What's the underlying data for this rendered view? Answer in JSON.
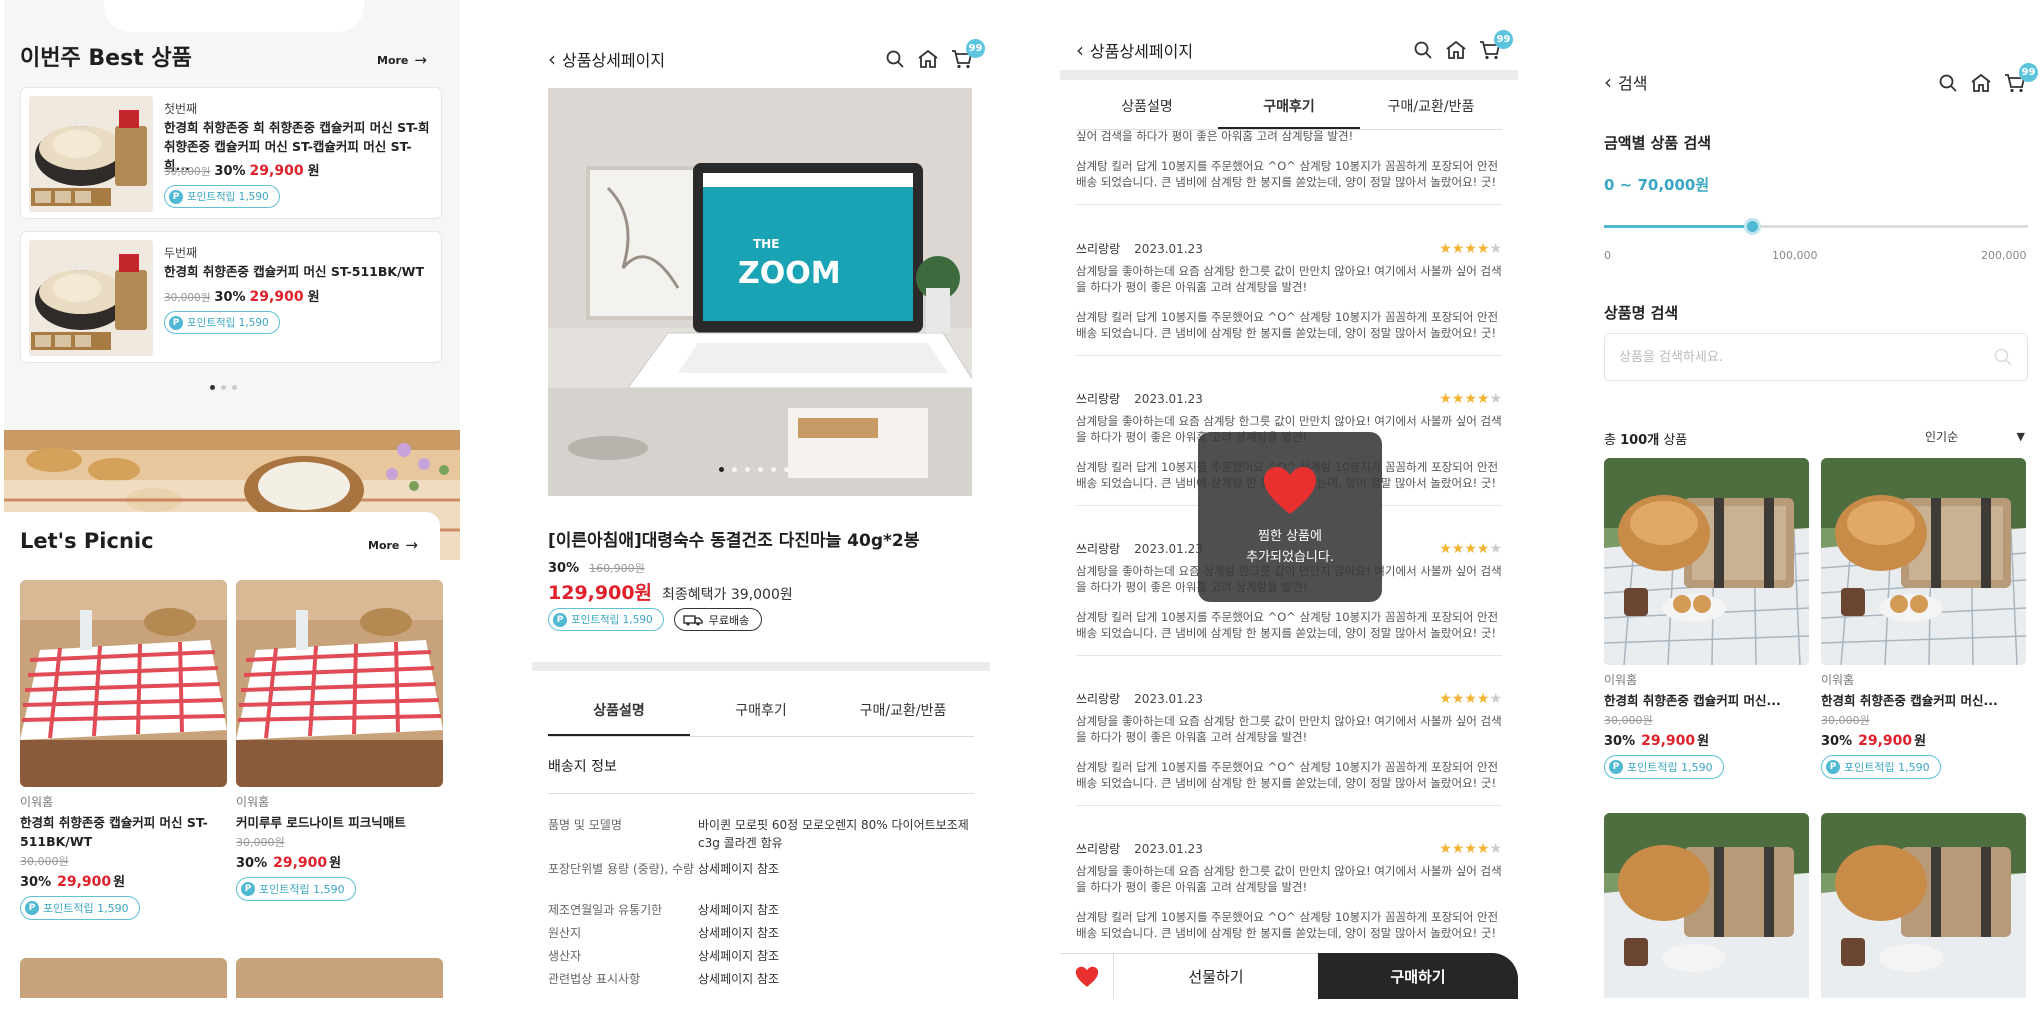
{
  "panel1": {
    "best_title": "이번주 Best 상품",
    "more_label": "More",
    "best_items": [
      {
        "rank": "첫번째",
        "name": "한경희 취향존중 희 취향존중 캡슐커피 머신 ST-희 취향존중 캡슐커피 머신 ST-캡슐커피 머신 ST-희...",
        "orig": "30,000원",
        "pct": "30%",
        "sale": "29,900",
        "won": "원",
        "point": "포인트적립 1,590"
      },
      {
        "rank": "두번째",
        "name": "한경희 취향존중 캡슐커피 머신 ST-511BK/WT",
        "orig": "30,000원",
        "pct": "30%",
        "sale": "29,900",
        "won": "원",
        "point": "포인트적립 1,590"
      }
    ],
    "picnic_title": "Let's Picnic",
    "picnic_items": [
      {
        "brand": "이워홈",
        "name": "한경희 취향존중 캡슐커피 머신 ST-511BK/WT",
        "orig": "30,000원",
        "pct": "30%",
        "sale": "29,900",
        "won": "원",
        "point": "포인트적립 1,590"
      },
      {
        "brand": "이워홈",
        "name": "커미루루 로드나이트 피크닉매트",
        "orig": "30,000원",
        "pct": "30%",
        "sale": "29,900",
        "won": "원",
        "point": "포인트적립 1,590"
      }
    ]
  },
  "panel2": {
    "header_title": "상품상세페이지",
    "cart_count": "99",
    "product_name": "[이른아침애]대령숙수 동결건조 다진마늘 40g*2봉",
    "discount_pct": "30%",
    "orig_price": "160,900원",
    "sale_price": "129,900원",
    "final_price": "최종혜택가 39,000원",
    "point": "포인트적립 1,590",
    "free_ship": "무료배송",
    "tabs": [
      "상품설명",
      "구매후기",
      "구매/교환/반품"
    ],
    "section": "배송지 정보",
    "specs": [
      {
        "k": "품명 및 모델명",
        "v": "바이퀸 모로핏 60정 모로오렌지 80% 다이어트보조제 c3g 콜라겐 함유"
      },
      {
        "k": "포장단위별 용량 (중량), 수량",
        "v": "상세페이지 참조"
      },
      {
        "k": "제조연월일과 유통기한",
        "v": "상세페이지 참조"
      },
      {
        "k": "원산지",
        "v": "상세페이지 참조"
      },
      {
        "k": "생산자",
        "v": "상세페이지 참조"
      },
      {
        "k": "관련법상 표시사항",
        "v": "상세페이지 참조"
      }
    ]
  },
  "panel3": {
    "header_title": "상품상세페이지",
    "cart_count": "99",
    "tabs": [
      "상품설명",
      "구매후기",
      "구매/교환/반품"
    ],
    "first_partial": "싶어 검색을 하다가 평이 좋은 아워홈 고려 삼계탕을 발견!",
    "first_body": "삼계탕 킬러 답게 10봉지를 주문했어요 ^O^ 삼계탕 10봉지가 꼼꼼하게 포장되어 안전배송 되었습니다. 큰 냄비에 삼계탕 한 봉지를 쏟았는데, 양이 정말 많아서 놀랐어요! 굿!",
    "reviews": [
      {
        "user": "쓰리랑랑",
        "date": "2023.01.23",
        "stars": "★★★★",
        "star_off": "★",
        "p1": "삼계탕을 좋아하는데 요즘 삼계탕 한그릇 값이 만만치 않아요! 여기에서 사볼까 싶어 검색을 하다가 평이 좋은 아워홈 고려 삼계탕을 발견!",
        "p2": "삼계탕 킬러 답게 10봉지를 주문했어요 ^O^ 삼계탕 10봉지가 꼼꼼하게 포장되어 안전배송 되었습니다. 큰 냄비에 삼계탕 한 봉지를 쏟았는데, 양이 정말 많아서 놀랐어요! 굿!"
      },
      {
        "user": "쓰리랑랑",
        "date": "2023.01.23",
        "stars": "★★★★",
        "star_off": "★",
        "p1": "삼계탕을 좋아하는데 요즘 삼계탕 한그릇 값이 만만치 않아요! 여기에서 사볼까 싶어 검색을 하다가 평이 좋은 아워홈 고려 삼계탕을 발견!",
        "p2": "삼계탕 킬러 답게 10봉지를 주문했어요 ^O^ 삼계탕 10봉지가 꼼꼼하게 포장되어 안전배송 되었습니다. 큰 냄비에 삼계탕 한 봉지를 쏟았는데, 양이 정말 많아서 놀랐어요! 굿!"
      },
      {
        "user": "쓰리랑랑",
        "date": "2023.01.23",
        "stars": "★★★★",
        "star_off": "★",
        "p1": "삼계탕을 좋아하는데 요즘 삼계탕 한그릇 값이 만만치 않아요! 여기에서 사볼까 싶어 검색을 하다가 평이 좋은 아워홈 고려 삼계탕을 발견!",
        "p2": "삼계탕 킬러 답게 10봉지를 주문했어요 ^O^ 삼계탕 10봉지가 꼼꼼하게 포장되어 안전배송 되었습니다. 큰 냄비에 삼계탕 한 봉지를 쏟았는데, 양이 정말 많아서 놀랐어요! 굿!"
      },
      {
        "user": "쓰리랑랑",
        "date": "2023.01.23",
        "stars": "★★★★",
        "star_off": "★",
        "p1": "삼계탕을 좋아하는데 요즘 삼계탕 한그릇 값이 만만치 않아요! 여기에서 사볼까 싶어 검색을 하다가 평이 좋은 아워홈 고려 삼계탕을 발견!",
        "p2": "삼계탕 킬러 답게 10봉지를 주문했어요 ^O^ 삼계탕 10봉지가 꼼꼼하게 포장되어 안전배송 되었습니다. 큰 냄비에 삼계탕 한 봉지를 쏟았는데, 양이 정말 많아서 놀랐어요! 굿!"
      },
      {
        "user": "쓰리랑랑",
        "date": "2023.01.23",
        "stars": "★★★★",
        "star_off": "★",
        "p1": "삼계탕을 좋아하는데 요즘 삼계탕 한그릇 값이 만만치 않아요! 여기에서 사볼까 싶어 검색을 하다가 평이 좋은 아워홈 고려 삼계탕을 발견!",
        "p2": "삼계탕 킬러 답게 10봉지를 주문했어요 ^O^ 삼계탕 10봉지가 꼼꼼하게 포장되어 안전배송 되었습니다. 큰 냄비에 삼계탕 한 봉지를 쏟았는데, 양이 정말 많아서 놀랐어요! 굿!"
      }
    ],
    "toast_line1": "찜한 상품에",
    "toast_line2": "추가되었습니다.",
    "gift_label": "선물하기",
    "buy_label": "구매하기"
  },
  "panel4": {
    "header_title": "검색",
    "cart_count": "99",
    "price_search_label": "금액별 상품 검색",
    "range_value": "0 ~ 70,000원",
    "slider_fraction": 0.35,
    "ticks": [
      "0",
      "100,000",
      "200,000"
    ],
    "name_search_label": "상품명 검색",
    "search_placeholder": "상품을 검색하세요.",
    "total_prefix": "총 ",
    "total_count": "100개",
    "total_suffix": " 상품",
    "sort_value": "인기순",
    "items": [
      {
        "brand": "이워홈",
        "name": "한경희 취향존중 캡슐커피 머신...",
        "orig": "30,000원",
        "pct": "30%",
        "sale": "29,900",
        "won": "원",
        "point": "포인트적립 1,590"
      },
      {
        "brand": "이워홈",
        "name": "한경희 취향존중 캡슐커피 머신...",
        "orig": "30,000원",
        "pct": "30%",
        "sale": "29,900",
        "won": "원",
        "point": "포인트적립 1,590"
      }
    ]
  },
  "colors": {
    "accent": "#4fb8d2",
    "sale_red": "#e0202a",
    "star": "#f4b331",
    "dark_button": "#262626"
  }
}
